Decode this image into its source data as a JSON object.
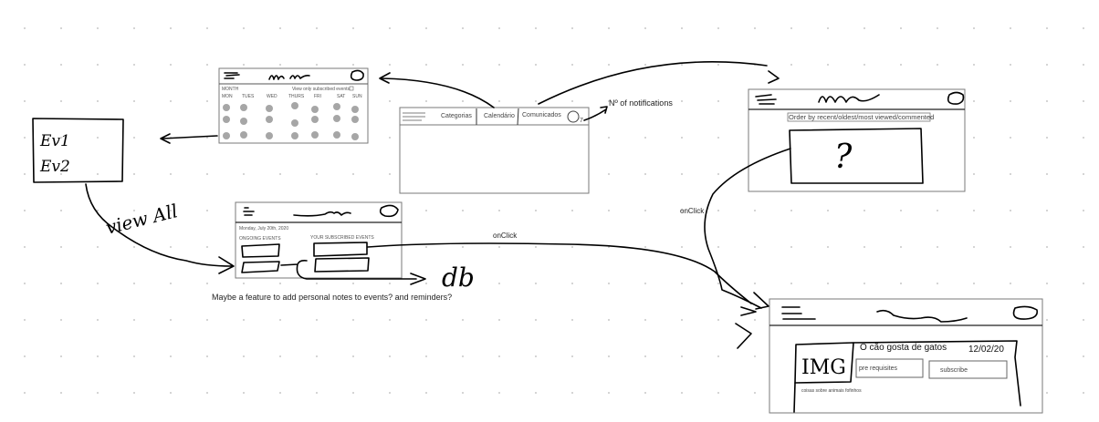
{
  "calendar_screen": {
    "month_label": "MONTH",
    "subscribed_toggle": "View only subscribed events",
    "days": [
      "MON",
      "TUES",
      "WED",
      "THURS",
      "FRI",
      "SAT",
      "SUN"
    ]
  },
  "events_popup": {
    "items": [
      "Ev1",
      "Ev2"
    ]
  },
  "view_all_label": "view All",
  "main_screen": {
    "tabs": [
      "Categorias",
      "Calendário",
      "Comunicados"
    ],
    "notification_count": "7"
  },
  "notifications_note": "Nº of notifications",
  "list_screen": {
    "order_by": "Order by recent/oldest/most viewed/commented",
    "placeholder": "?"
  },
  "home_screen": {
    "date": "Monday, July 20th, 2020",
    "ongoing_label": "ONGOING EVENTS",
    "subscribed_label": "YOUR SUBSCRIBED EVENTS"
  },
  "db_label": "db",
  "feature_note": "Maybe a feature to add personal notes to events? and reminders?",
  "onclick_labels": [
    "onClick",
    "onClick"
  ],
  "event_screen": {
    "image_placeholder": "IMG",
    "title": "O cão gosta de gatos",
    "date": "12/02/20",
    "prerequisites_button": "pre requisites",
    "subscribe_button": "subscribe",
    "description": "coisas sobre animais fofinhos"
  }
}
